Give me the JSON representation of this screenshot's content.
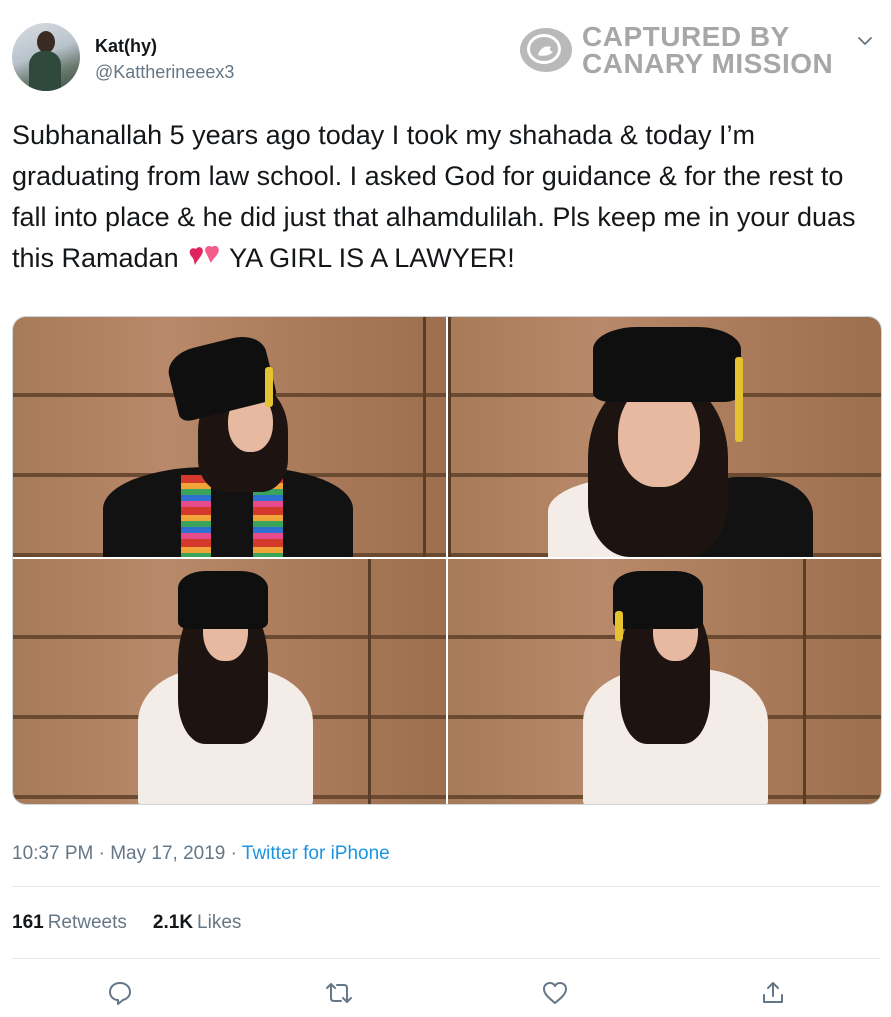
{
  "tweet": {
    "display_name": "Kat(hy)",
    "handle": "@Kattherineeex3",
    "text": "Subhanallah 5 years ago today I took my shahada & today I’m graduating from law school. I asked God for guidance & for the rest to fall into place & he did just that alhamdulilah. Pls keep me in your duas this Ramadan",
    "text_end": " YA GIRL IS A LAWYER!",
    "emoji": "two-hearts-icon",
    "time": "10:37 PM",
    "separator": " · ",
    "date": "May 17, 2019",
    "source": "Twitter for iPhone"
  },
  "watermark": {
    "line1": "CAPTURED BY",
    "line2": "CANARY MISSION"
  },
  "stats": {
    "retweets_count": "161",
    "retweets_label": "Retweets",
    "likes_count": "2.1K",
    "likes_label": "Likes"
  },
  "media": {
    "photos": [
      "graduate-in-gown-with-stole",
      "graduate-closeup-cap",
      "graduate-white-dress-front",
      "graduate-white-dress-side"
    ]
  },
  "actions": [
    "reply-icon",
    "retweet-icon",
    "like-icon",
    "share-icon"
  ],
  "colors": {
    "link": "#1b95e0",
    "muted": "#657786",
    "text": "#14171a",
    "watermark": "#a7a7a7"
  }
}
